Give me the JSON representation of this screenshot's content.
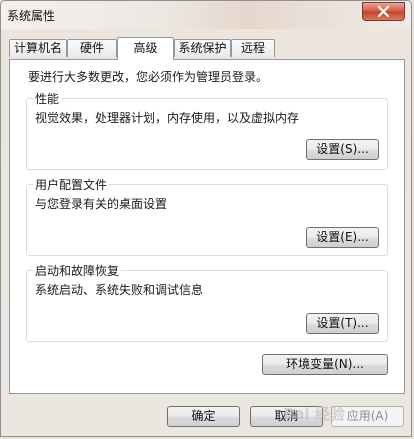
{
  "window": {
    "title": "系统属性"
  },
  "tabs": [
    {
      "label": "计算机名"
    },
    {
      "label": "硬件"
    },
    {
      "label": "高级"
    },
    {
      "label": "系统保护"
    },
    {
      "label": "远程"
    }
  ],
  "active_tab": "高级",
  "admin_note": "要进行大多数更改，您必须作为管理员登录。",
  "groups": {
    "performance": {
      "title": "性能",
      "description": "视觉效果，处理器计划，内存使用，以及虚拟内存",
      "button": "设置(S)..."
    },
    "user_profiles": {
      "title": "用户配置文件",
      "description": "与您登录有关的桌面设置",
      "button": "设置(E)..."
    },
    "startup_recovery": {
      "title": "启动和故障恢复",
      "description": "系统启动、系统失败和调试信息",
      "button": "设置(T)..."
    }
  },
  "env_button": "环境变量(N)...",
  "footer": {
    "ok": "确定",
    "cancel": "取消",
    "apply": "应用(A)"
  },
  "watermark": "Bai 经验",
  "colors": {
    "close_button": "#c2432b",
    "border": "#8e9aa6"
  }
}
